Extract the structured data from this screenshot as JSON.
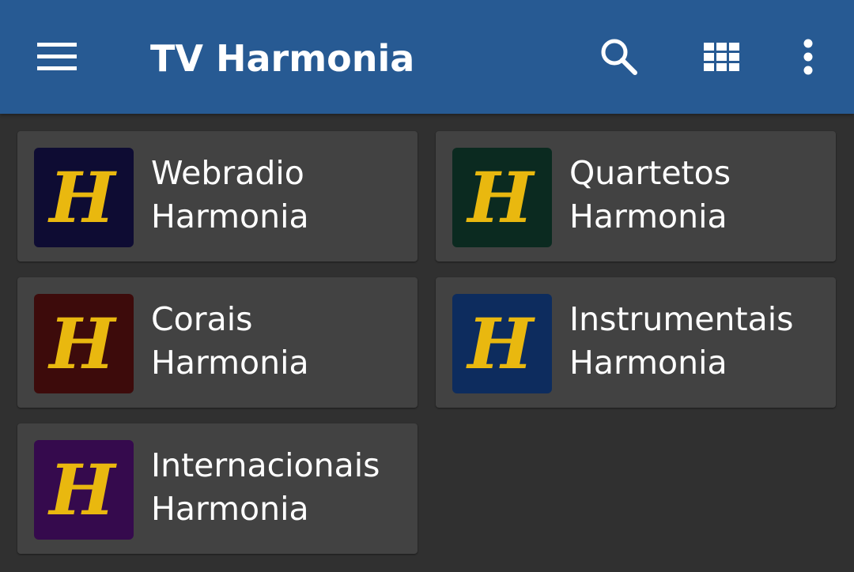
{
  "appbar": {
    "title": "TV Harmonia",
    "icons": [
      "menu-icon",
      "search-icon",
      "grid-view-icon",
      "more-vert-icon"
    ],
    "background": "#275a93"
  },
  "logo_letter": "H",
  "channels": [
    {
      "line1": "Webradio",
      "line2": "Harmonia",
      "logo_bg": "#0e0c33"
    },
    {
      "line1": "Quartetos",
      "line2": "Harmonia",
      "logo_bg": "#0b2a20"
    },
    {
      "line1": "Corais",
      "line2": "Harmonia",
      "logo_bg": "#3d0b0b"
    },
    {
      "line1": "Instrumentais",
      "line2": "Harmonia",
      "logo_bg": "#0d2c5e"
    },
    {
      "line1": "Internacionais",
      "line2": "Harmonia",
      "logo_bg": "#350a4d"
    }
  ],
  "colors": {
    "page_bg": "#303030",
    "card_bg": "#424242",
    "logo_letter": "#e9b80f",
    "text": "#ffffff"
  }
}
